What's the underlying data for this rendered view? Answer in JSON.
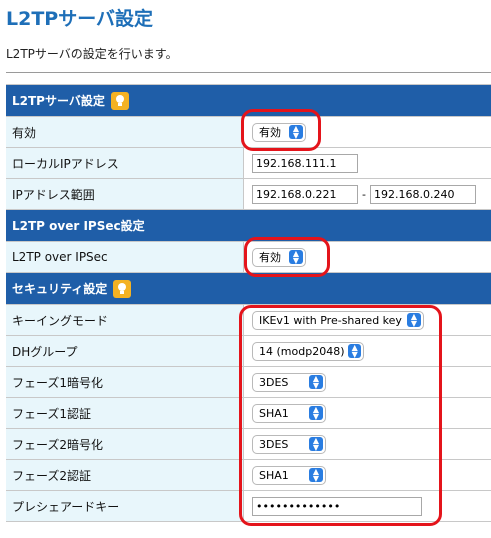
{
  "page": {
    "title": "L2TPサーバ設定",
    "description": "L2TPサーバの設定を行います。"
  },
  "sections": {
    "l2tp": {
      "heading": "L2TPサーバ設定",
      "enabled_label": "有効",
      "enabled_value": "有効",
      "local_ip_label": "ローカルIPアドレス",
      "local_ip_value": "192.168.111.1",
      "ip_range_label": "IPアドレス範囲",
      "ip_range_start": "192.168.0.221",
      "ip_range_separator": "-",
      "ip_range_end": "192.168.0.240"
    },
    "ipsec": {
      "heading": "L2TP over IPSec設定",
      "enabled_label": "L2TP over IPSec",
      "enabled_value": "有効"
    },
    "security": {
      "heading": "セキュリティ設定",
      "keying_mode_label": "キーイングモード",
      "keying_mode_value": "IKEv1 with Pre-shared key",
      "dh_group_label": "DHグループ",
      "dh_group_value": "14 (modp2048)",
      "phase1_enc_label": "フェーズ1暗号化",
      "phase1_enc_value": "3DES",
      "phase1_auth_label": "フェーズ1認証",
      "phase1_auth_value": "SHA1",
      "phase2_enc_label": "フェーズ2暗号化",
      "phase2_enc_value": "3DES",
      "phase2_auth_label": "フェーズ2認証",
      "phase2_auth_value": "SHA1",
      "psk_label": "プレシェアードキー",
      "psk_value": "•••••••••••••"
    }
  },
  "colors": {
    "title": "#1e6fb8",
    "section_bg": "#1f5ea8",
    "label_bg": "#e8f6fb",
    "bulb": "#f4b223",
    "highlight": "#e4141b",
    "chevron": "#2a7de1"
  },
  "icons": {
    "section_hint": "lightbulb-icon",
    "select_arrow": "chevron-updown-icon"
  }
}
